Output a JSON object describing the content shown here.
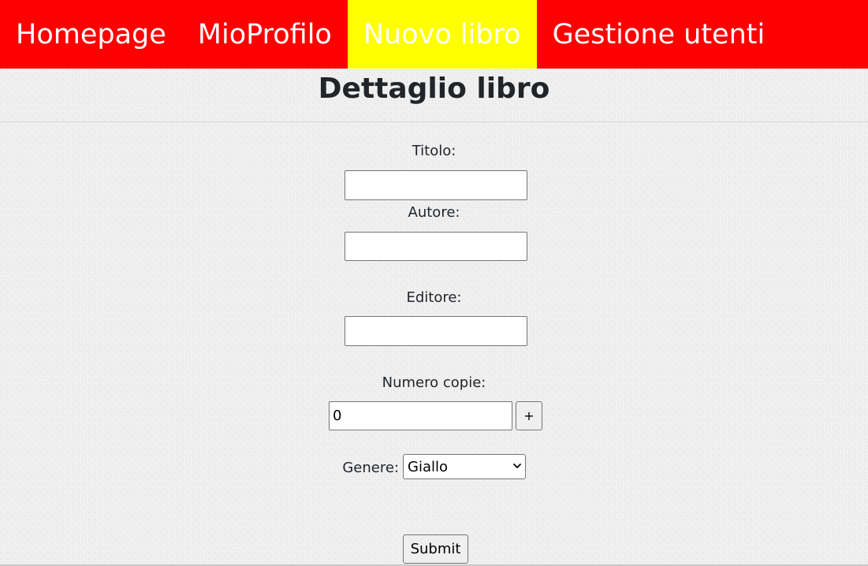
{
  "nav": {
    "items": [
      {
        "label": "Homepage"
      },
      {
        "label": "MioProfilo"
      },
      {
        "label": "Nuovo libro"
      },
      {
        "label": "Gestione utenti"
      }
    ],
    "active_item": "Nuovo libro",
    "background_color": "#ff0000",
    "active_color": "#ffff00"
  },
  "page": {
    "title": "Dettaglio libro"
  },
  "form": {
    "titolo": {
      "label": "Titolo:",
      "value": ""
    },
    "autore": {
      "label": "Autore:",
      "value": ""
    },
    "editore": {
      "label": "Editore:",
      "value": ""
    },
    "numero_copie": {
      "label": "Numero copie:",
      "value": "0",
      "increment_label": "+"
    },
    "genere": {
      "label": "Genere:",
      "selected": "Giallo",
      "icon": "chevron-down-icon"
    },
    "submit_label": "Submit"
  }
}
